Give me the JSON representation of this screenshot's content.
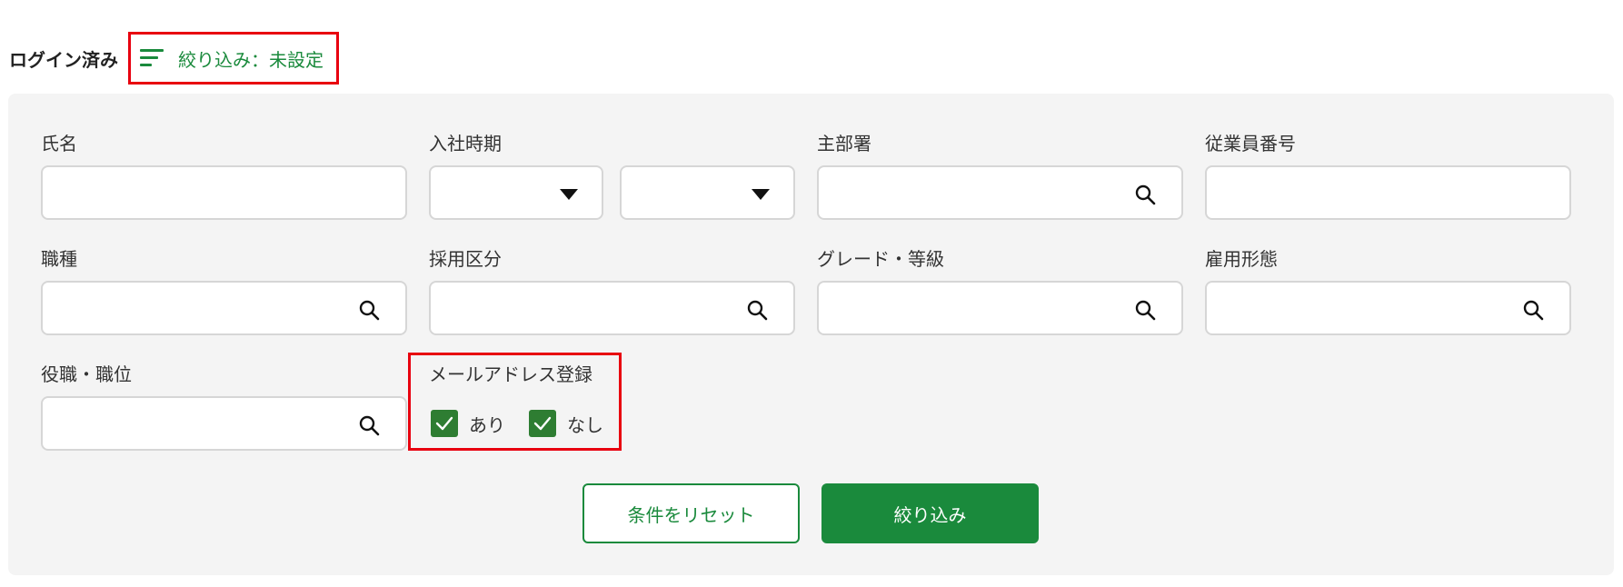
{
  "header": {
    "title": "ログイン済み",
    "filter_toggle_label": "絞り込み：未設定"
  },
  "fields": {
    "name": {
      "label": "氏名"
    },
    "hire_date": {
      "label": "入社時期"
    },
    "department": {
      "label": "主部署"
    },
    "employee_number": {
      "label": "従業員番号"
    },
    "job_type": {
      "label": "職種"
    },
    "hiring_category": {
      "label": "採用区分"
    },
    "grade": {
      "label": "グレード・等級"
    },
    "employment_type": {
      "label": "雇用形態"
    },
    "position": {
      "label": "役職・職位"
    },
    "email_registration": {
      "label": "メールアドレス登録",
      "options": [
        {
          "label": "あり",
          "checked": true
        },
        {
          "label": "なし",
          "checked": true
        }
      ]
    }
  },
  "buttons": {
    "reset_label": "条件をリセット",
    "apply_label": "絞り込み"
  },
  "colors": {
    "accent": "#1a8a3c",
    "checkbox": "#2e7d32",
    "highlight": "#e8000f",
    "panel_bg": "#f4f4f4"
  },
  "icons": {
    "filter": "filter-lines-icon",
    "search": "search-icon",
    "dropdown": "caret-down-icon",
    "check": "check-icon"
  }
}
